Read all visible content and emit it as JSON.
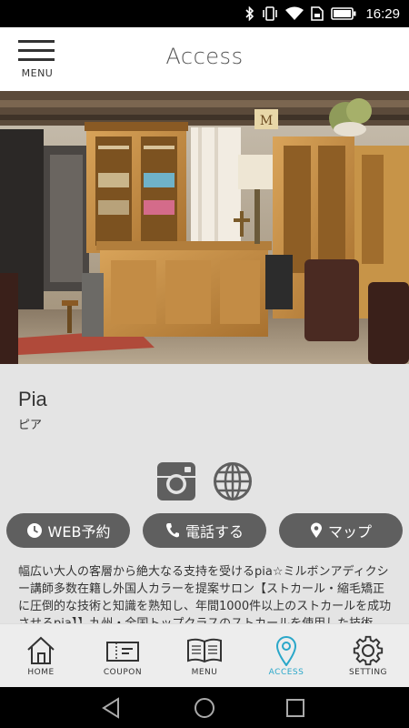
{
  "status_bar": {
    "time": "16:29"
  },
  "header": {
    "menu_label": "MENU",
    "title": "Access"
  },
  "shop": {
    "name": "Pia",
    "kana": "ピア",
    "description": "幅広い大人の客層から絶大なる支持を受けるpia☆ミルボンアディクシー講師多数在籍し外国人カラーを提案サロン【ストカール・縮毛矯正に圧倒的な技術と知識を熟知し、年間1000件以上のストカールを成功させるpia】】九州・全国トップクラスのストカールを使用した技術を…毛先パーマを…"
  },
  "social": [
    {
      "name": "instagram-icon"
    },
    {
      "name": "web-icon"
    }
  ],
  "actions": {
    "web_label": "WEB予約",
    "tel_label": "電話する",
    "map_label": "マップ"
  },
  "tabs": [
    {
      "label": "HOME",
      "icon": "home-icon"
    },
    {
      "label": "COUPON",
      "icon": "coupon-icon"
    },
    {
      "label": "MENU",
      "icon": "book-icon"
    },
    {
      "label": "ACCESS",
      "icon": "map-pin-icon",
      "active": true
    },
    {
      "label": "SETTING",
      "icon": "gear-icon"
    }
  ],
  "colors": {
    "accent": "#2aa7c9",
    "pill": "#5f5f5f",
    "content_bg": "#e4e4e4"
  }
}
